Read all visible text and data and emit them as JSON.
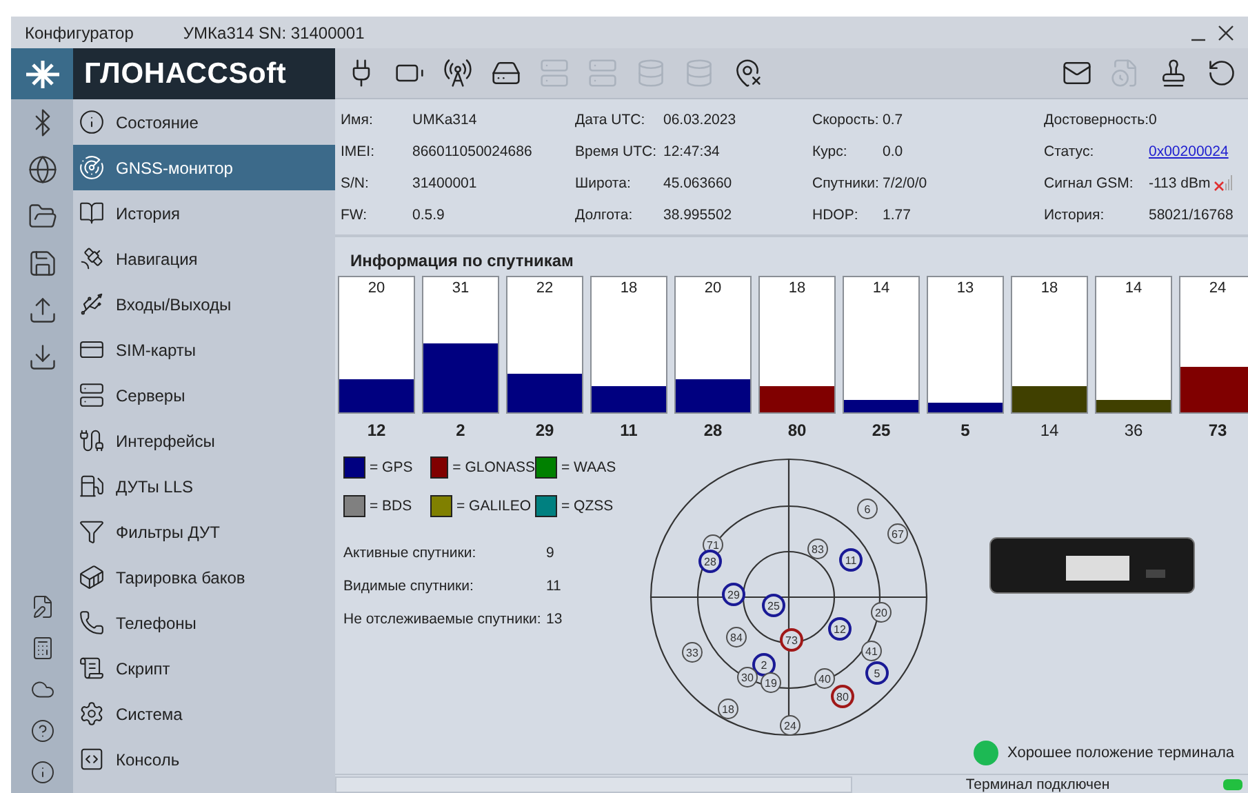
{
  "window": {
    "title": "Конфигуратор",
    "device": "УМКа314 SN: 31400001"
  },
  "logo": "ГЛОНАССSoft",
  "toolbar_left": [
    {
      "kind": "plug",
      "disabled": false
    },
    {
      "kind": "battery",
      "disabled": false
    },
    {
      "kind": "antenna",
      "disabled": false
    },
    {
      "kind": "server-error",
      "disabled": false
    },
    {
      "kind": "server",
      "disabled": true
    },
    {
      "kind": "server",
      "disabled": true
    },
    {
      "kind": "db-refresh",
      "disabled": true
    },
    {
      "kind": "db-gear",
      "disabled": true
    },
    {
      "kind": "pin-x",
      "disabled": false
    }
  ],
  "toolbar_right": [
    {
      "kind": "mail",
      "disabled": false
    },
    {
      "kind": "file-refresh",
      "disabled": true
    },
    {
      "kind": "stamp",
      "disabled": false
    },
    {
      "kind": "replay",
      "disabled": false
    }
  ],
  "nav": [
    {
      "label": "Состояние",
      "selected": false
    },
    {
      "label": "GNSS-монитор",
      "selected": true
    },
    {
      "label": "История",
      "selected": false
    },
    {
      "label": "Навигация",
      "selected": false
    },
    {
      "label": "Входы/Выходы",
      "selected": false
    },
    {
      "label": "SIM-карты",
      "selected": false
    },
    {
      "label": "Серверы",
      "selected": false
    },
    {
      "label": "Интерфейсы",
      "selected": false
    },
    {
      "label": "ДУТы LLS",
      "selected": false
    },
    {
      "label": "Фильтры ДУТ",
      "selected": false
    },
    {
      "label": "Тарировка баков",
      "selected": false
    },
    {
      "label": "Телефоны",
      "selected": false
    },
    {
      "label": "Скрипт",
      "selected": false
    },
    {
      "label": "Система",
      "selected": false
    },
    {
      "label": "Консоль",
      "selected": false
    }
  ],
  "info": [
    [
      {
        "label": "Имя:",
        "value": "UMKa314",
        "kind": "text"
      },
      {
        "label": "IMEI:",
        "value": "866011050024686",
        "kind": "text"
      },
      {
        "label": "S/N:",
        "value": "31400001",
        "kind": "text"
      },
      {
        "label": "FW:",
        "value": "0.5.9",
        "kind": "text"
      }
    ],
    [
      {
        "label": "Дата UTC:",
        "value": "06.03.2023",
        "kind": "text"
      },
      {
        "label": "Время UTC:",
        "value": "12:47:34",
        "kind": "text"
      },
      {
        "label": "Широта:",
        "value": "45.063660",
        "kind": "text"
      },
      {
        "label": "Долгота:",
        "value": "38.995502",
        "kind": "text"
      }
    ],
    [
      {
        "label": "Скорость:",
        "value": "0.7",
        "kind": "text"
      },
      {
        "label": "Курс:",
        "value": "0.0",
        "kind": "text"
      },
      {
        "label": "Спутники:",
        "value": "7/2/0/0",
        "kind": "text"
      },
      {
        "label": "HDOP:",
        "value": "1.77",
        "kind": "text"
      }
    ],
    [
      {
        "label": "Достоверность:",
        "value": "0",
        "kind": "text"
      },
      {
        "label": "Статус:",
        "value": "0x00200024",
        "kind": "link"
      },
      {
        "label": "Сигнал GSM:",
        "value": "-113 dBm",
        "kind": "signal"
      },
      {
        "label": "История:",
        "value": "58021/16768",
        "kind": "text"
      }
    ]
  ],
  "section_title": "Информация по спутникам",
  "bars": [
    {
      "snr": "20",
      "sat": "12",
      "level": 0.24,
      "color": "#000080",
      "active": true
    },
    {
      "snr": "31",
      "sat": "2",
      "level": 0.51,
      "color": "#000080",
      "active": true
    },
    {
      "snr": "22",
      "sat": "29",
      "level": 0.29,
      "color": "#000080",
      "active": true
    },
    {
      "snr": "18",
      "sat": "11",
      "level": 0.19,
      "color": "#000080",
      "active": true
    },
    {
      "snr": "20",
      "sat": "28",
      "level": 0.24,
      "color": "#000080",
      "active": true
    },
    {
      "snr": "18",
      "sat": "80",
      "level": 0.19,
      "color": "#800000",
      "active": true
    },
    {
      "snr": "14",
      "sat": "25",
      "level": 0.09,
      "color": "#000080",
      "active": true
    },
    {
      "snr": "13",
      "sat": "5",
      "level": 0.07,
      "color": "#000080",
      "active": true
    },
    {
      "snr": "18",
      "sat": "14",
      "level": 0.19,
      "color": "#404000",
      "active": false
    },
    {
      "snr": "14",
      "sat": "36",
      "level": 0.09,
      "color": "#404000",
      "active": false
    },
    {
      "snr": "24",
      "sat": "73",
      "level": 0.34,
      "color": "#800000",
      "active": true
    }
  ],
  "legend": [
    {
      "label": "= GPS",
      "color": "#000080"
    },
    {
      "label": "= GLONASS",
      "color": "#800000"
    },
    {
      "label": "= WAAS",
      "color": "#008000"
    },
    {
      "label": "= BDS",
      "color": "#808080"
    },
    {
      "label": "= GALILEO",
      "color": "#808000"
    },
    {
      "label": "= QZSS",
      "color": "#008080"
    }
  ],
  "stats": [
    {
      "label": "Активные спутники:",
      "value": "9"
    },
    {
      "label": "Видимые спутники:",
      "value": "11"
    },
    {
      "label": "Не отслеживаемые спутники:",
      "value": "13"
    }
  ],
  "satellites": [
    {
      "label": "6",
      "color": "#505050"
    },
    {
      "label": "67",
      "color": "#505050"
    },
    {
      "label": "71",
      "color": "#505050"
    },
    {
      "label": "28",
      "color": "#1a1a96"
    },
    {
      "label": "83",
      "color": "#505050"
    },
    {
      "label": "11",
      "color": "#1a1a96"
    },
    {
      "label": "29",
      "color": "#1a1a96"
    },
    {
      "label": "25",
      "color": "#1a1a96"
    },
    {
      "label": "20",
      "color": "#505050"
    },
    {
      "label": "84",
      "color": "#505050"
    },
    {
      "label": "73",
      "color": "#a01818"
    },
    {
      "label": "12",
      "color": "#1a1a96"
    },
    {
      "label": "33",
      "color": "#505050"
    },
    {
      "label": "2",
      "color": "#1a1a96"
    },
    {
      "label": "41",
      "color": "#505050"
    },
    {
      "label": "5",
      "color": "#1a1a96"
    },
    {
      "label": "30",
      "color": "#505050"
    },
    {
      "label": "19",
      "color": "#505050"
    },
    {
      "label": "40",
      "color": "#505050"
    },
    {
      "label": "80",
      "color": "#a01818"
    },
    {
      "label": "18",
      "color": "#505050"
    },
    {
      "label": "24",
      "color": "#505050"
    }
  ],
  "position": {
    "text": "Хорошее положение терминала",
    "color": "#1db954"
  },
  "status_bar": {
    "text": "Терминал подключен",
    "connected": true
  }
}
